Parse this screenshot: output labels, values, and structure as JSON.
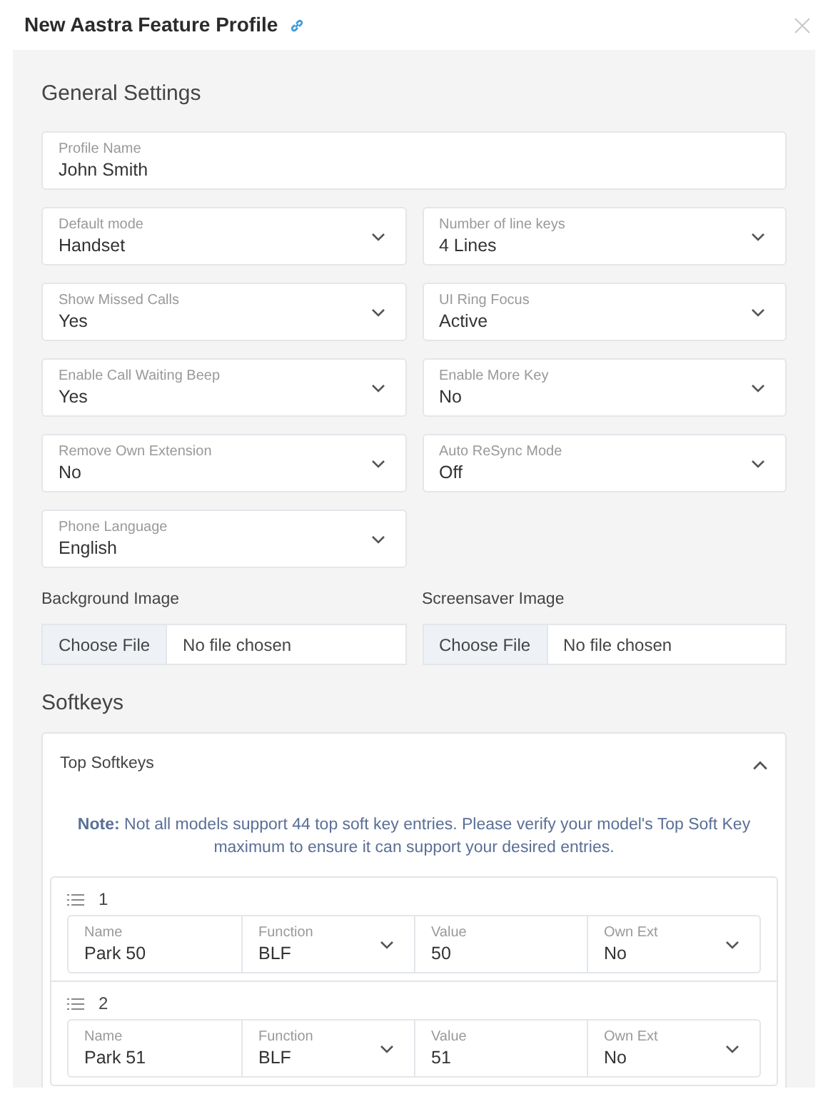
{
  "header": {
    "title": "New Aastra Feature Profile"
  },
  "general_settings": {
    "heading": "General Settings",
    "fields": [
      {
        "kind": "text",
        "label": "Profile Name",
        "value": "John Smith"
      },
      {
        "kind": "select",
        "label": "Default mode",
        "value": "Handset"
      },
      {
        "kind": "select",
        "label": "Number of line keys",
        "value": "4 Lines"
      },
      {
        "kind": "select",
        "label": "Show Missed Calls",
        "value": "Yes"
      },
      {
        "kind": "select",
        "label": "UI Ring Focus",
        "value": "Active"
      },
      {
        "kind": "select",
        "label": "Enable Call Waiting Beep",
        "value": "Yes"
      },
      {
        "kind": "select",
        "label": "Enable More Key",
        "value": "No"
      },
      {
        "kind": "select",
        "label": "Remove Own Extension",
        "value": "No"
      },
      {
        "kind": "select",
        "label": "Auto ReSync Mode",
        "value": "Off"
      },
      {
        "kind": "select",
        "label": "Phone Language",
        "value": "English"
      }
    ],
    "file_inputs": [
      {
        "label": "Background Image",
        "button": "Choose File",
        "status": "No file chosen"
      },
      {
        "label": "Screensaver Image",
        "button": "Choose File",
        "status": "No file chosen"
      }
    ]
  },
  "softkeys": {
    "heading": "Softkeys",
    "panel": {
      "title": "Top Softkeys",
      "expanded": true,
      "note": "**Note:** Not all models support 44 top soft key entries. Please verify your model's Top Soft Key maximum to ensure it can support your desired entries.",
      "rows": [
        {
          "number": "1",
          "cells": [
            {
              "kind": "text",
              "label": "Name",
              "value": "Park 50"
            },
            {
              "kind": "select",
              "label": "Function",
              "value": "BLF"
            },
            {
              "kind": "text",
              "label": "Value",
              "value": "50"
            },
            {
              "kind": "select",
              "label": "Own Ext",
              "value": "No"
            }
          ]
        },
        {
          "number": "2",
          "cells": [
            {
              "kind": "text",
              "label": "Name",
              "value": "Park 51"
            },
            {
              "kind": "select",
              "label": "Function",
              "value": "BLF"
            },
            {
              "kind": "text",
              "label": "Value",
              "value": "51"
            },
            {
              "kind": "select",
              "label": "Own Ext",
              "value": "No"
            }
          ]
        }
      ]
    }
  }
}
